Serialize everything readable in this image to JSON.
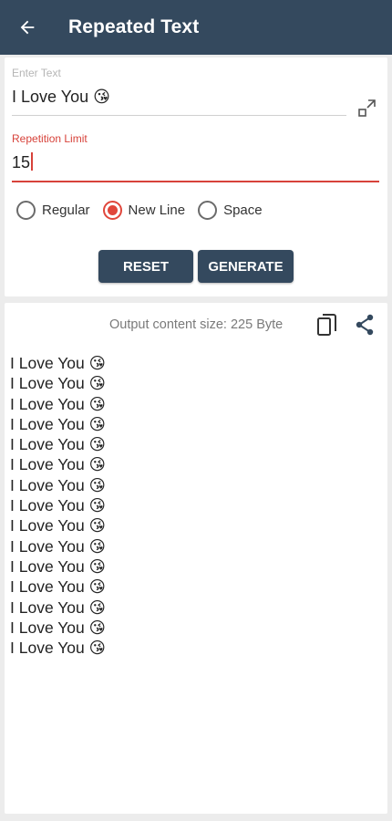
{
  "appbar": {
    "title": "Repeated Text",
    "back_icon": "arrow-left-icon"
  },
  "input": {
    "text_label": "Enter Text",
    "text_value": "I Love You 😘",
    "limit_label": "Repetition Limit",
    "limit_value": "15"
  },
  "mode": {
    "options": [
      "Regular",
      "New Line",
      "Space"
    ],
    "selected": "New Line"
  },
  "buttons": {
    "reset": "RESET",
    "generate": "GENERATE"
  },
  "output": {
    "size_text": "Output content size: 225 Byte",
    "lines": [
      "I Love You 😘",
      "I Love You 😘",
      "I Love You 😘",
      "I Love You 😘",
      "I Love You 😘",
      "I Love You 😘",
      "I Love You 😘",
      "I Love You 😘",
      "I Love You 😘",
      "I Love You 😘",
      "I Love You 😘",
      "I Love You 😘",
      "I Love You 😘",
      "I Love You 😘",
      "I Love You 😘"
    ]
  },
  "colors": {
    "primary": "#34495e",
    "accent": "#d7423a"
  }
}
